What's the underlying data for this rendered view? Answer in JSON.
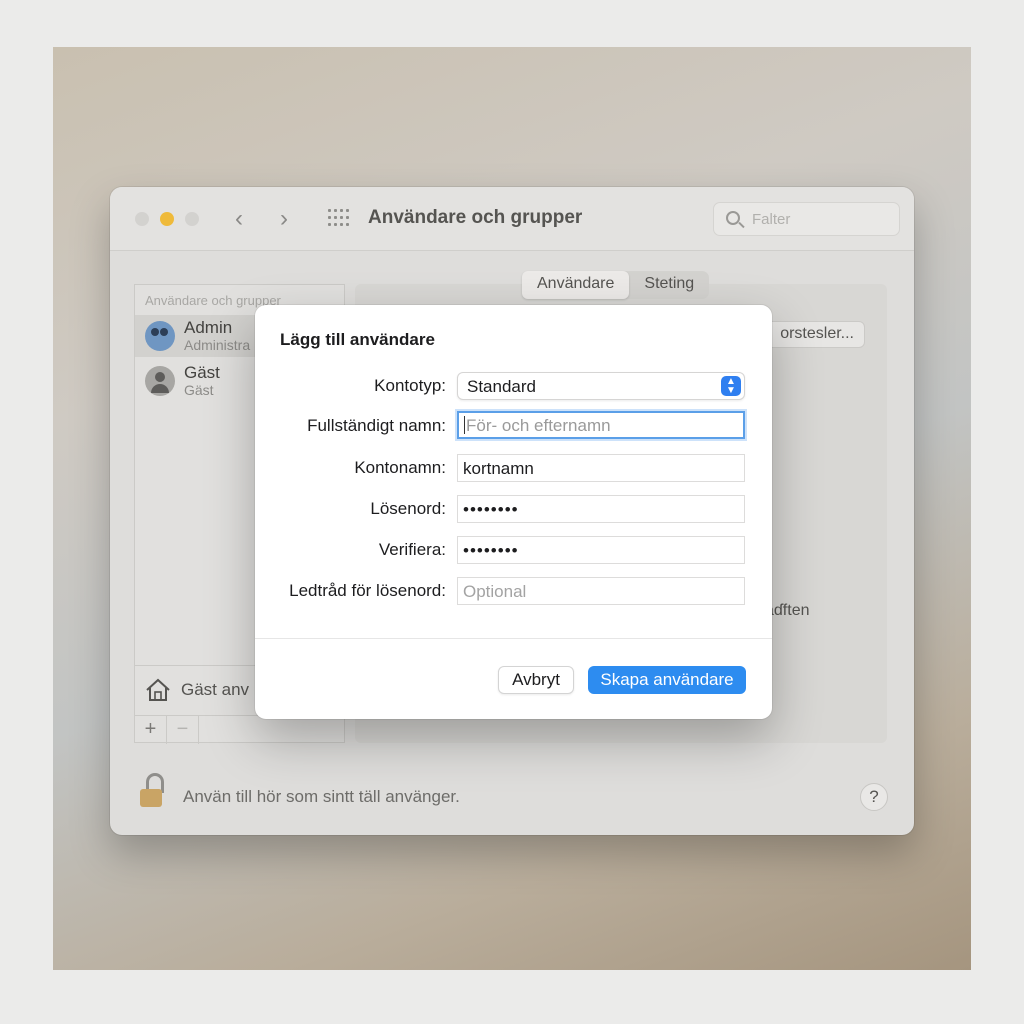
{
  "window": {
    "title": "Användare och grupper",
    "search_placeholder": "Falter"
  },
  "sidebar": {
    "header": "Användare och grupper",
    "users": [
      {
        "name": "Admin",
        "role": "Administra"
      },
      {
        "name": "Gäst",
        "role": "Gäst"
      }
    ],
    "guest_option": "Gäst anv",
    "add_label": "+",
    "remove_label": "−"
  },
  "tabs": [
    "Användare",
    "Steting"
  ],
  "background": {
    "settings_button": "orstesler...",
    "partial_text": "aɗften"
  },
  "footer": {
    "lock_text": "Använ till hör som sintt täll använger.",
    "help_label": "?"
  },
  "dialog": {
    "title": "Lägg till användare",
    "fields": {
      "account_type": {
        "label": "Kontotyp:",
        "value": "Standard"
      },
      "full_name": {
        "label": "Fullständigt namn:",
        "placeholder": "För- och efternamn"
      },
      "account_name": {
        "label": "Kontonamn:",
        "value": "kortnamn"
      },
      "password": {
        "label": "Lösenord:",
        "value": "••••••••"
      },
      "verify": {
        "label": "Verifiera:",
        "value": "••••••••"
      },
      "hint": {
        "label": "Ledtråd för lösenord:",
        "placeholder": "Optional"
      }
    },
    "cancel_label": "Avbryt",
    "create_label": "Skapa användare"
  },
  "colors": {
    "accent": "#2d8cf0",
    "traffic_yellow": "#efba3a"
  }
}
